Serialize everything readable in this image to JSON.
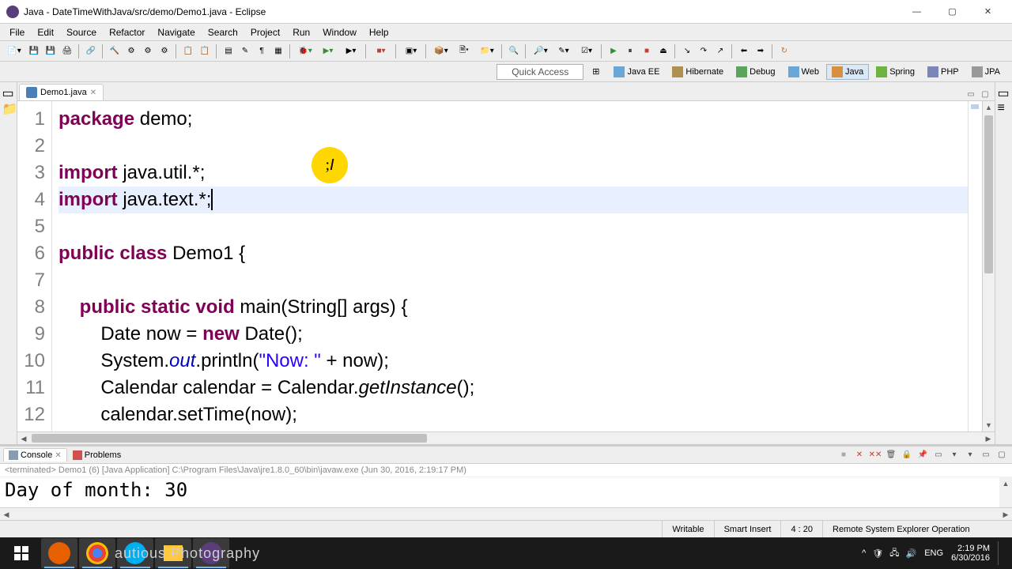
{
  "window": {
    "title": "Java - DateTimeWithJava/src/demo/Demo1.java - Eclipse",
    "min": "—",
    "max": "▢",
    "close": "✕"
  },
  "menu": [
    "File",
    "Edit",
    "Source",
    "Refactor",
    "Navigate",
    "Search",
    "Project",
    "Run",
    "Window",
    "Help"
  ],
  "quick_access": "Quick Access",
  "perspectives": [
    {
      "label": "Java EE",
      "icon": "#6aa7d6"
    },
    {
      "label": "Hibernate",
      "icon": "#b09050"
    },
    {
      "label": "Debug",
      "icon": "#5aa55a"
    },
    {
      "label": "Web",
      "icon": "#6aa7d6"
    },
    {
      "label": "Java",
      "icon": "#d89040",
      "active": true
    },
    {
      "label": "Spring",
      "icon": "#6db33f"
    },
    {
      "label": "PHP",
      "icon": "#7a86b8"
    },
    {
      "label": "JPA",
      "icon": "#999"
    }
  ],
  "editor": {
    "tab_label": "Demo1.java",
    "line_numbers": [
      "1",
      "2",
      "3",
      "4",
      "5",
      "6",
      "7",
      "8",
      "9",
      "10",
      "11",
      "12"
    ],
    "lines": [
      {
        "n": 1,
        "tokens": [
          {
            "t": "package",
            "c": "kw"
          },
          {
            "t": " demo;",
            "c": ""
          }
        ]
      },
      {
        "n": 2,
        "tokens": [
          {
            "t": "",
            "c": ""
          }
        ]
      },
      {
        "n": 3,
        "tokens": [
          {
            "t": "import",
            "c": "kw"
          },
          {
            "t": " java.util.*;",
            "c": ""
          }
        ]
      },
      {
        "n": 4,
        "hl": true,
        "tokens": [
          {
            "t": "import",
            "c": "kw"
          },
          {
            "t": " java.text.*;",
            "c": ""
          }
        ],
        "cursor": true
      },
      {
        "n": 5,
        "tokens": [
          {
            "t": "",
            "c": ""
          }
        ]
      },
      {
        "n": 6,
        "tokens": [
          {
            "t": "public",
            "c": "kw"
          },
          {
            "t": " ",
            "c": ""
          },
          {
            "t": "class",
            "c": "kw"
          },
          {
            "t": " Demo1 {",
            "c": ""
          }
        ]
      },
      {
        "n": 7,
        "tokens": [
          {
            "t": "",
            "c": ""
          }
        ]
      },
      {
        "n": 8,
        "tokens": [
          {
            "t": "    ",
            "c": ""
          },
          {
            "t": "public",
            "c": "kw"
          },
          {
            "t": " ",
            "c": ""
          },
          {
            "t": "static",
            "c": "kw"
          },
          {
            "t": " ",
            "c": ""
          },
          {
            "t": "void",
            "c": "kw"
          },
          {
            "t": " main(String[] args) {",
            "c": ""
          }
        ]
      },
      {
        "n": 9,
        "tokens": [
          {
            "t": "        Date now = ",
            "c": ""
          },
          {
            "t": "new",
            "c": "kw"
          },
          {
            "t": " Date();",
            "c": ""
          }
        ]
      },
      {
        "n": 10,
        "tokens": [
          {
            "t": "        System.",
            "c": ""
          },
          {
            "t": "out",
            "c": "fld"
          },
          {
            "t": ".println(",
            "c": ""
          },
          {
            "t": "\"Now: \"",
            "c": "str"
          },
          {
            "t": " + now);",
            "c": ""
          }
        ]
      },
      {
        "n": 11,
        "tokens": [
          {
            "t": "        Calendar ",
            "c": ""
          },
          {
            "t": "calendar",
            "c": ""
          },
          {
            "t": " = Calendar.",
            "c": ""
          },
          {
            "t": "getInstance",
            "c": "st-it"
          },
          {
            "t": "();",
            "c": ""
          }
        ]
      },
      {
        "n": 12,
        "tokens": [
          {
            "t": "        calendar.setTime(now);",
            "c": ""
          }
        ]
      }
    ],
    "highlight_char": ";"
  },
  "console": {
    "tabs": [
      "Console",
      "Problems"
    ],
    "header": "<terminated> Demo1 (6) [Java Application] C:\\Program Files\\Java\\jre1.8.0_60\\bin\\javaw.exe (Jun 30, 2016, 2:19:17 PM)",
    "output": "Day of month: 30"
  },
  "statusbar": {
    "writable": "Writable",
    "mode": "Smart Insert",
    "pos": "4 : 20",
    "op": "Remote System Explorer Operation"
  },
  "taskbar": {
    "center_text": "autious Photography",
    "lang": "ENG",
    "time": "2:19 PM",
    "date": "6/30/2016"
  }
}
